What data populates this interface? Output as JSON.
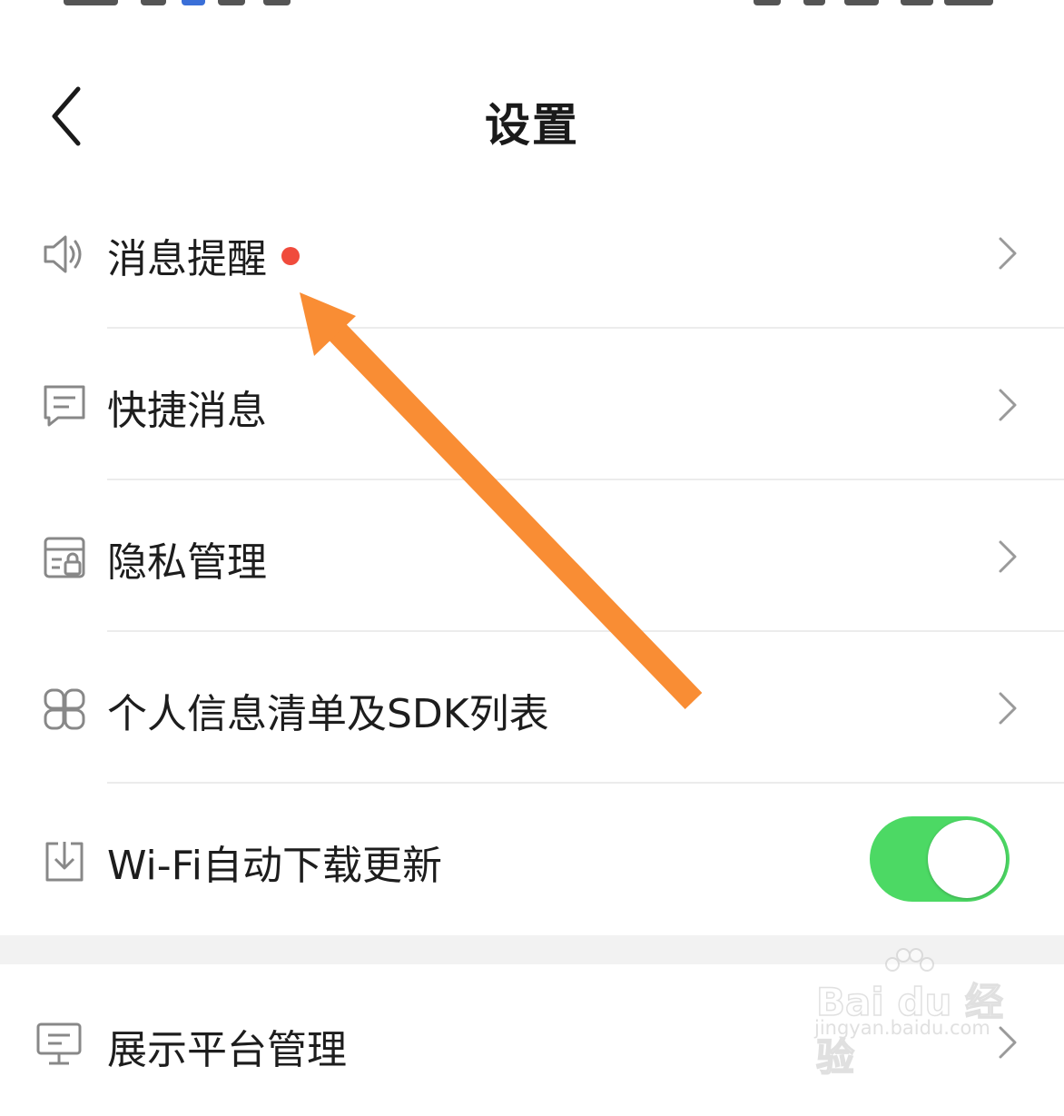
{
  "header": {
    "title": "设置"
  },
  "items": [
    {
      "label": "消息提醒",
      "icon": "speaker-icon",
      "badge": "red-dot"
    },
    {
      "label": "快捷消息",
      "icon": "message-icon"
    },
    {
      "label": "隐私管理",
      "icon": "privacy-icon"
    },
    {
      "label": "个人信息清单及SDK列表",
      "icon": "grid-icon"
    },
    {
      "label": "Wi-Fi自动下载更新",
      "icon": "download-icon",
      "toggle": "on"
    }
  ],
  "section2": {
    "label": "展示平台管理",
    "icon": "monitor-icon"
  },
  "colors": {
    "toggle_on": "#4cd964",
    "badge": "#f04b3c",
    "annotation_arrow": "#f98d34"
  },
  "watermark": {
    "brand": "Bai du 经验",
    "url": "jingyan.baidu.com"
  }
}
